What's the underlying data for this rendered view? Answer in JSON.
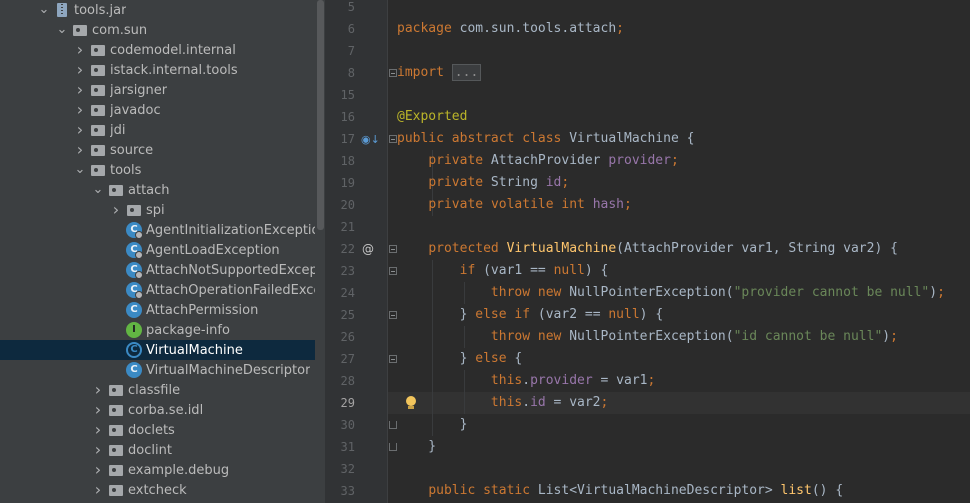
{
  "tree": {
    "items": [
      {
        "label": "tools.jar",
        "depth": 2,
        "expanded": true,
        "icon": "jar-icon"
      },
      {
        "label": "com.sun",
        "depth": 3,
        "expanded": true,
        "icon": "package-icon"
      },
      {
        "label": "codemodel.internal",
        "depth": 4,
        "expanded": false,
        "icon": "package-icon"
      },
      {
        "label": "istack.internal.tools",
        "depth": 4,
        "expanded": false,
        "icon": "package-icon"
      },
      {
        "label": "jarsigner",
        "depth": 4,
        "expanded": false,
        "icon": "package-icon"
      },
      {
        "label": "javadoc",
        "depth": 4,
        "expanded": false,
        "icon": "package-icon"
      },
      {
        "label": "jdi",
        "depth": 4,
        "expanded": false,
        "icon": "package-icon"
      },
      {
        "label": "source",
        "depth": 4,
        "expanded": false,
        "icon": "package-icon"
      },
      {
        "label": "tools",
        "depth": 4,
        "expanded": true,
        "icon": "package-icon"
      },
      {
        "label": "attach",
        "depth": 5,
        "expanded": true,
        "icon": "package-icon"
      },
      {
        "label": "spi",
        "depth": 6,
        "expanded": false,
        "icon": "package-icon"
      },
      {
        "label": "AgentInitializationException",
        "depth": 6,
        "leaf": true,
        "icon": "exception-class-icon"
      },
      {
        "label": "AgentLoadException",
        "depth": 6,
        "leaf": true,
        "icon": "exception-class-icon"
      },
      {
        "label": "AttachNotSupportedException",
        "depth": 6,
        "leaf": true,
        "icon": "exception-class-icon"
      },
      {
        "label": "AttachOperationFailedException",
        "depth": 6,
        "leaf": true,
        "icon": "exception-class-icon"
      },
      {
        "label": "AttachPermission",
        "depth": 6,
        "leaf": true,
        "icon": "class-icon"
      },
      {
        "label": "package-info",
        "depth": 6,
        "leaf": true,
        "icon": "package-info-icon"
      },
      {
        "label": "VirtualMachine",
        "depth": 6,
        "leaf": true,
        "icon": "abstract-class-icon",
        "selected": true
      },
      {
        "label": "VirtualMachineDescriptor",
        "depth": 6,
        "leaf": true,
        "icon": "class-icon"
      },
      {
        "label": "classfile",
        "depth": 5,
        "expanded": false,
        "icon": "package-icon"
      },
      {
        "label": "corba.se.idl",
        "depth": 5,
        "expanded": false,
        "icon": "package-icon"
      },
      {
        "label": "doclets",
        "depth": 5,
        "expanded": false,
        "icon": "package-icon"
      },
      {
        "label": "doclint",
        "depth": 5,
        "expanded": false,
        "icon": "package-icon"
      },
      {
        "label": "example.debug",
        "depth": 5,
        "expanded": false,
        "icon": "package-icon"
      },
      {
        "label": "extcheck",
        "depth": 5,
        "expanded": false,
        "icon": "package-icon"
      }
    ]
  },
  "editor": {
    "current_line": "29",
    "lines": [
      {
        "n": "5",
        "code": ""
      },
      {
        "n": "6",
        "code": "package com.sun.tools.attach;"
      },
      {
        "n": "7",
        "code": ""
      },
      {
        "n": "8",
        "code": "import ..."
      },
      {
        "n": "15",
        "code": ""
      },
      {
        "n": "16",
        "code": "@Exported"
      },
      {
        "n": "17",
        "code": "public abstract class VirtualMachine {"
      },
      {
        "n": "18",
        "code": "    private AttachProvider provider;"
      },
      {
        "n": "19",
        "code": "    private String id;"
      },
      {
        "n": "20",
        "code": "    private volatile int hash;"
      },
      {
        "n": "21",
        "code": ""
      },
      {
        "n": "22",
        "code": "    protected VirtualMachine(AttachProvider var1, String var2) {"
      },
      {
        "n": "23",
        "code": "        if (var1 == null) {"
      },
      {
        "n": "24",
        "code": "            throw new NullPointerException(\"provider cannot be null\");"
      },
      {
        "n": "25",
        "code": "        } else if (var2 == null) {"
      },
      {
        "n": "26",
        "code": "            throw new NullPointerException(\"id cannot be null\");"
      },
      {
        "n": "27",
        "code": "        } else {"
      },
      {
        "n": "28",
        "code": "            this.provider = var1;"
      },
      {
        "n": "29",
        "code": "            this.id = var2;"
      },
      {
        "n": "30",
        "code": "        }"
      },
      {
        "n": "31",
        "code": "    }"
      },
      {
        "n": "32",
        "code": ""
      },
      {
        "n": "33",
        "code": "    public static List<VirtualMachineDescriptor> list() {"
      }
    ]
  },
  "colors": {
    "keyword": "#cc7832",
    "annotation": "#bbb529",
    "field": "#9876aa",
    "method": "#ffc66d",
    "string": "#6a8759",
    "text": "#a9b7c6",
    "selection": "#0d293e"
  }
}
